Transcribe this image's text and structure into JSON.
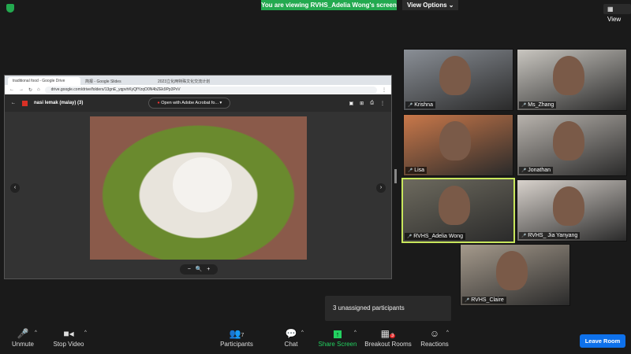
{
  "top": {
    "banner": "You are viewing RVHS_Adelia Wong's screen",
    "view_options": "View Options",
    "view": "View"
  },
  "browser": {
    "tabs": [
      "traditional food - Google Drive",
      "简报 - Google Slides",
      "2023立化两特殊文化交流计划"
    ],
    "url": "drive.google.com/drive/folders/13gnE_yqpvhKyQfYzqO0N4bZEk9Pp3PvV",
    "file_name": "nasi lemak (malay) (3)",
    "open_with": "Open with Adobe Acrobat fo...",
    "zoom_controls": [
      "−",
      "🔍",
      "+"
    ]
  },
  "participants": [
    {
      "name": "Krishna",
      "color": "#8a8f96"
    },
    {
      "name": "Ms_Zhang",
      "color": "#c9c6c0"
    },
    {
      "name": "Lisa",
      "color": "#c9784a"
    },
    {
      "name": "Jonathan",
      "color": "#b8b3ad"
    },
    {
      "name": "RVHS_Adelia Wong",
      "color": "#6d6a5e"
    },
    {
      "name": "RVHS_ Jia Yanyang",
      "color": "#d8d2cc"
    },
    {
      "name": "RVHS_Claire",
      "color": "#a59a8c"
    }
  ],
  "tooltip": "3 unassigned participants",
  "toolbar": {
    "unmute": "Unmute",
    "stop_video": "Stop Video",
    "participants": "Participants",
    "participants_count": "7",
    "chat": "Chat",
    "share_screen": "Share Screen",
    "breakout": "Breakout Rooms",
    "breakout_badge": "3",
    "reactions": "Reactions",
    "leave": "Leave Room"
  }
}
